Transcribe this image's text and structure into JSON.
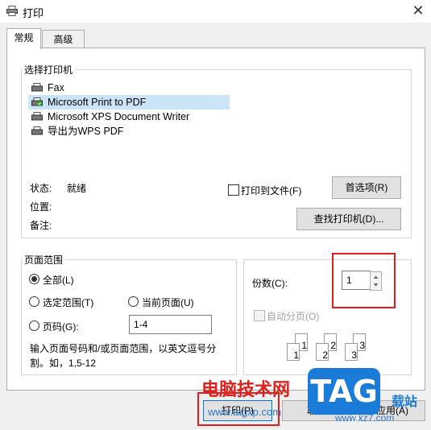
{
  "window": {
    "title": "打印",
    "close_glyph": "✕"
  },
  "tabs": [
    {
      "label": "常规",
      "active": true
    },
    {
      "label": "高级",
      "active": false
    }
  ],
  "select_printer": {
    "group_label": "选择打印机",
    "printers": [
      {
        "name": "Fax",
        "icon": "fax-printer-icon"
      },
      {
        "name": "Microsoft Print to PDF",
        "icon": "default-printer-icon",
        "selected": true
      },
      {
        "name": "Microsoft XPS Document Writer",
        "icon": "printer-icon"
      },
      {
        "name": "导出为WPS PDF",
        "icon": "printer-icon"
      }
    ],
    "status_label": "状态:",
    "status_value": "就绪",
    "location_label": "位置:",
    "comment_label": "备注:",
    "print_to_file_label": "打印到文件(F)",
    "preferences_button": "首选项(R)",
    "find_printer_button": "查找打印机(D)..."
  },
  "page_range": {
    "group_label": "页面范围",
    "all_label": "全部(L)",
    "selection_label": "选定范围(T)",
    "current_page_label": "当前页面(U)",
    "pages_label": "页码(G):",
    "pages_value": "1-4",
    "hint": "输入页面号码和/或页面范围，以英文逗号分割。如，1,5-12"
  },
  "copies": {
    "label": "份数(C):",
    "value": "1",
    "collate_label": "自动分页(O)",
    "collate_pages": [
      "1",
      "1",
      "2",
      "2",
      "3",
      "3"
    ]
  },
  "bottom_buttons": {
    "print": "打印(P)",
    "cancel": "取消",
    "apply": "应用(A)"
  },
  "watermark": {
    "site_cn": "电脑技术网",
    "tag": "TAG",
    "url": "www.tagxp.com",
    "site_cn2": "载站",
    "url2": "www.xz7.com"
  },
  "colors": {
    "selection": "#cce4f7",
    "highlight_box": "#e31d1d",
    "watermark_blue": "#1b7bd8"
  }
}
